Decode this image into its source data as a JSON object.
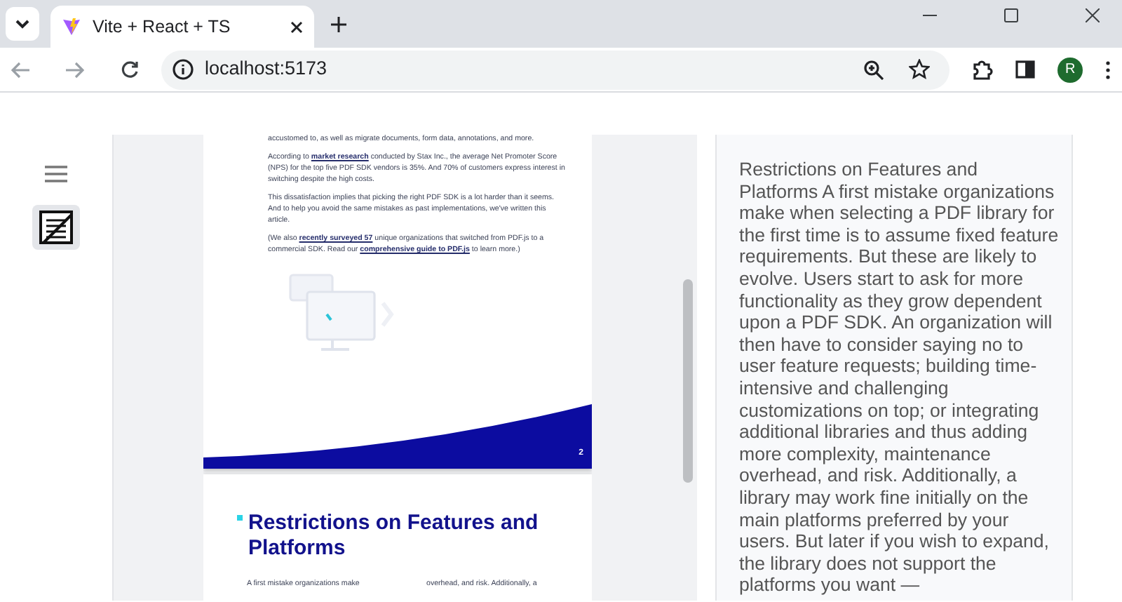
{
  "browser": {
    "tab_title": "Vite + React + TS",
    "url": "localhost:5173",
    "profile_initial": "R"
  },
  "pdf_pages": [
    {
      "paragraphs": [
        [
          {
            "text": "accustomed to, as well as migrate documents, form data, annotations, and more.",
            "link": false
          }
        ],
        [
          {
            "text": "According to ",
            "link": false
          },
          {
            "text": "market research",
            "link": true
          },
          {
            "text": " conducted by Stax Inc., the average Net Promoter Score (NPS) for the top five PDF SDK vendors is 35%. And 70% of customers express interest in switching despite the high costs.",
            "link": false
          }
        ],
        [
          {
            "text": "This dissatisfaction implies that picking the right PDF SDK is a lot harder than it seems. And to help you avoid the same mistakes as past implementations, we've written this article.",
            "link": false
          }
        ],
        [
          {
            "text": "(We also ",
            "link": false
          },
          {
            "text": "recently surveyed 57",
            "link": true
          },
          {
            "text": " unique organizations that switched from PDF.js to a commercial SDK. Read our ",
            "link": false
          },
          {
            "text": "comprehensive guide to PDF.js",
            "link": true
          },
          {
            "text": " to learn more.)",
            "link": false
          }
        ]
      ],
      "page_number": "2"
    },
    {
      "heading": "Restrictions on Features and Platforms",
      "columns": [
        "A first mistake organizations make",
        "overhead, and risk. Additionally, a"
      ]
    }
  ],
  "extracted_text": "Restrictions on Features and Platforms A first mistake organizations make when selecting a PDF library for the first time is to assume fixed feature requirements. But these are likely to evolve. Users start to ask for more functionality as they grow dependent upon a PDF SDK. An organization will then have to consider saying no to user feature requests; building time-intensive and challenging customizations on top; or integrating additional libraries and thus adding more complexity, maintenance overhead, and risk. Additionally, a library may work fine initially on the main platforms preferred by your users. But later if you wish to expand, the library does not support the platforms you want —"
}
